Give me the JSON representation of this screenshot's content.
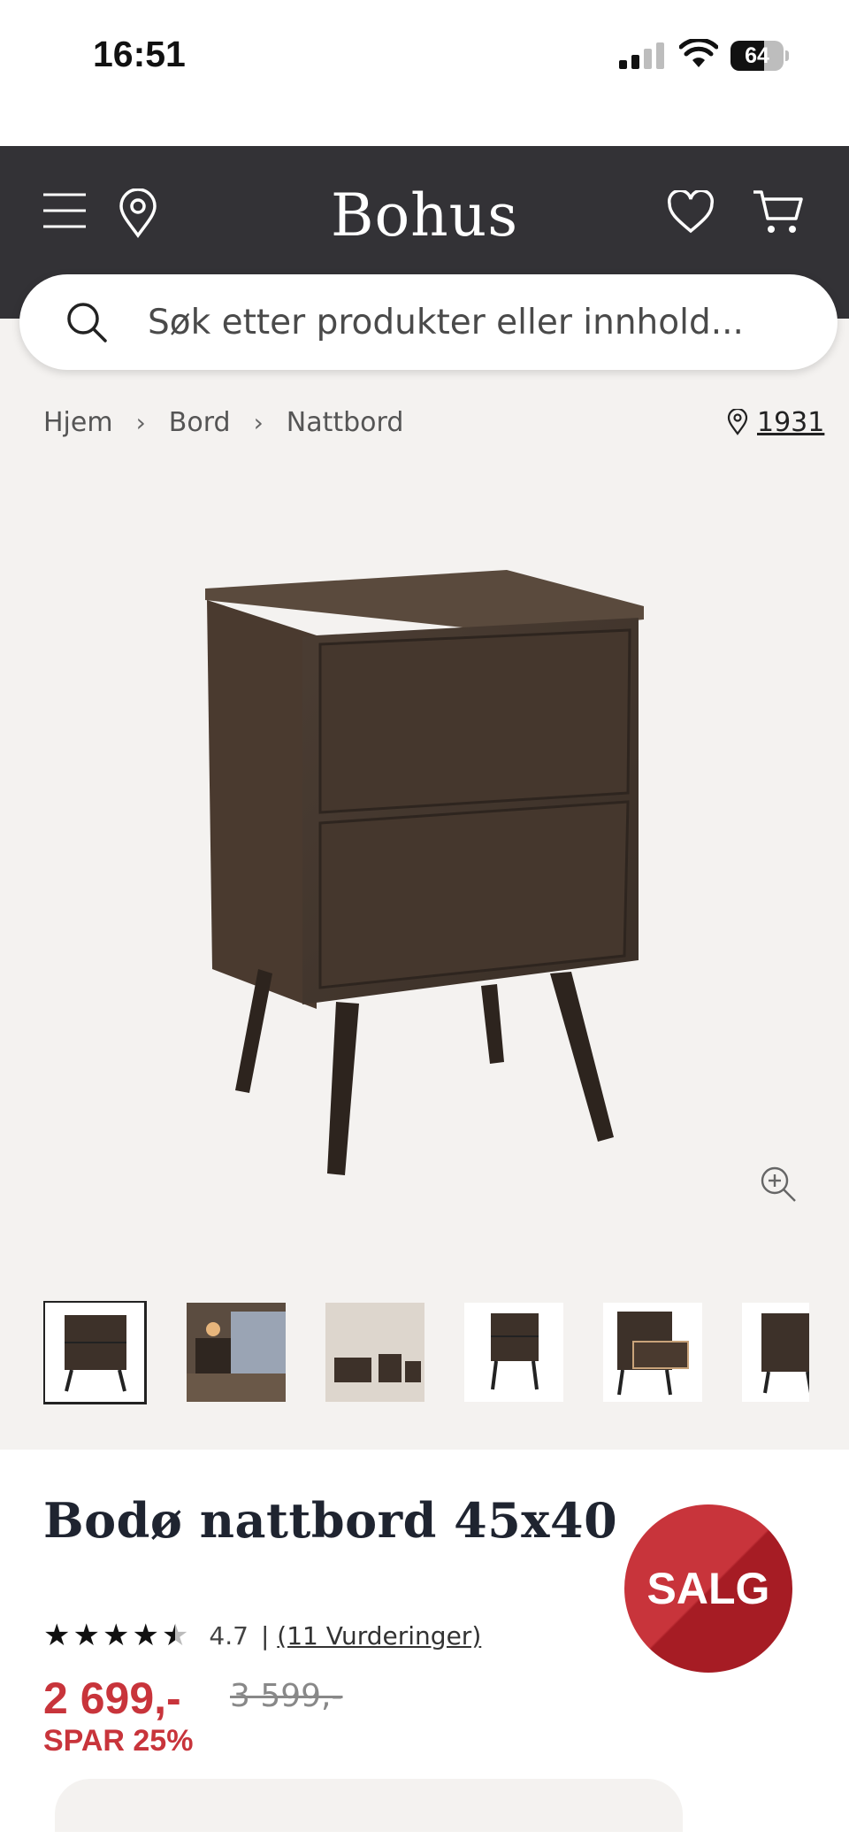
{
  "status_bar": {
    "time": "16:51",
    "battery": "64",
    "battery_level": 0.64
  },
  "header": {
    "logo": "Bohus",
    "menu_icon": "menu-icon",
    "location_icon": "map-pin-icon",
    "wishlist_icon": "heart-icon",
    "cart_icon": "cart-icon"
  },
  "search": {
    "placeholder": "Søk etter produkter eller innhold...",
    "value": ""
  },
  "breadcrumb": {
    "items": [
      "Hjem",
      "Bord",
      "Nattbord"
    ],
    "separator": "›"
  },
  "store": {
    "label": "1931",
    "icon": "map-pin-icon"
  },
  "gallery": {
    "thumbnail_count": 6,
    "active_index": 0
  },
  "product": {
    "title": "Bodø nattbord 45x40",
    "badge": "SALG",
    "rating_value": "4.7",
    "rating_stars": 4.5,
    "rating_divider": "|",
    "reviews_link": "(11 Vurderinger)",
    "price": "2 699,-",
    "old_price": "3 599,-",
    "saving": "SPAR 25%"
  },
  "colors": {
    "header_bg": "#333236",
    "sale_red": "#c8343b",
    "page_bg": "#f4f2f0"
  }
}
